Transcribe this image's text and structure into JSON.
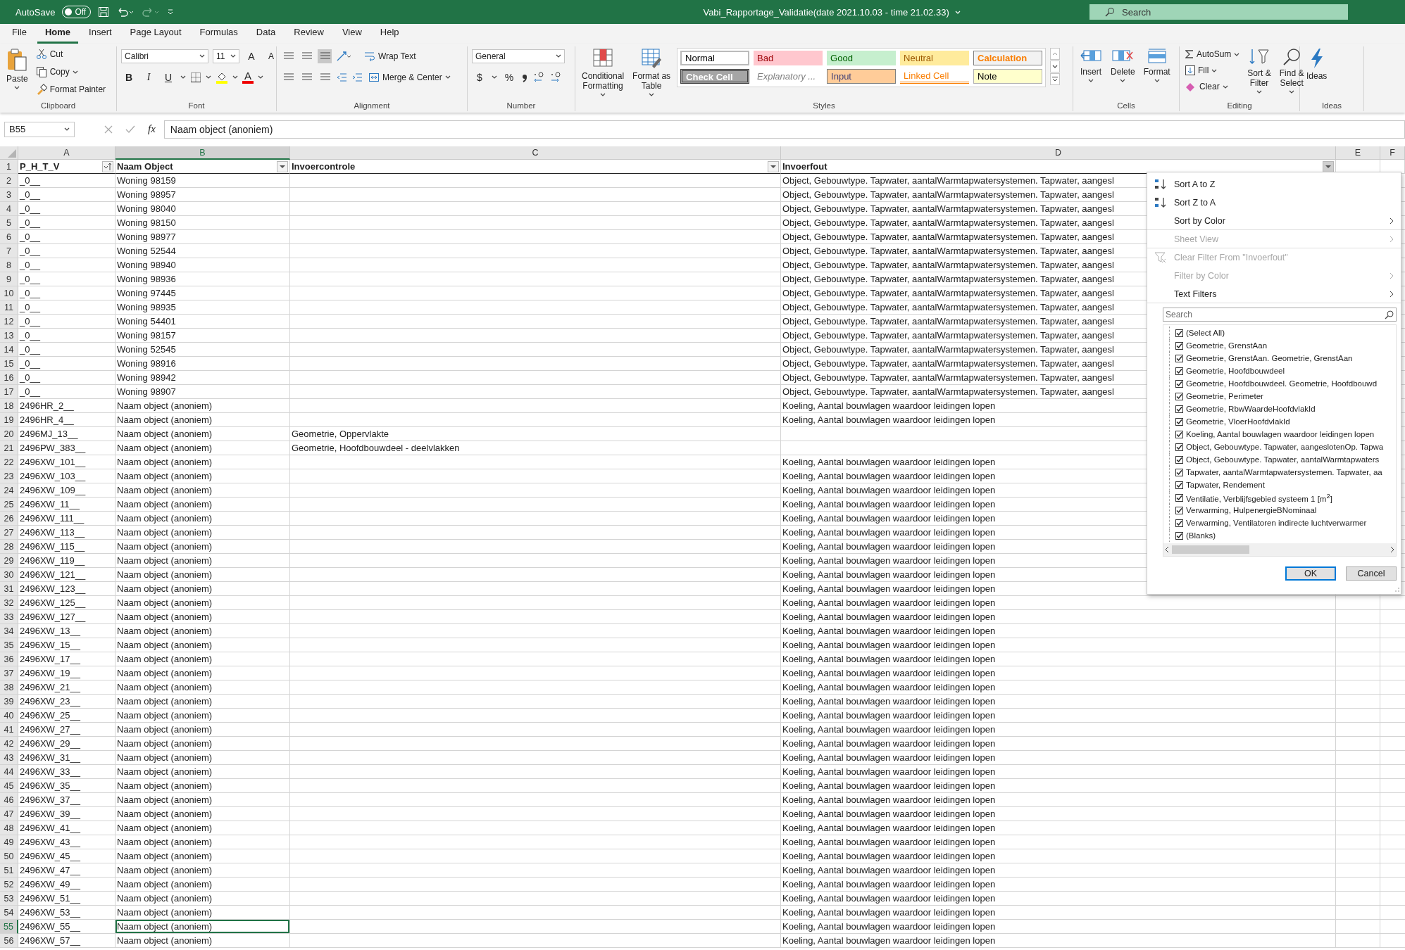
{
  "title_bar": {
    "autosave": {
      "label": "AutoSave",
      "state": "Off",
      "on": false
    },
    "title": "Vabi_Rapportage_Validatie(date 2021.10.03 - time 21.02.33)",
    "search": {
      "placeholder": "Search"
    }
  },
  "menu_tabs": [
    {
      "label": "File",
      "selected": false
    },
    {
      "label": "Home",
      "selected": true
    },
    {
      "label": "Insert",
      "selected": false
    },
    {
      "label": "Page Layout",
      "selected": false
    },
    {
      "label": "Formulas",
      "selected": false
    },
    {
      "label": "Data",
      "selected": false
    },
    {
      "label": "Review",
      "selected": false
    },
    {
      "label": "View",
      "selected": false
    },
    {
      "label": "Help",
      "selected": false
    }
  ],
  "ribbon": {
    "clipboard": {
      "label": "Clipboard",
      "paste": "Paste",
      "cut": "Cut",
      "copy": "Copy",
      "format_painter": "Format Painter"
    },
    "font": {
      "label": "Font",
      "family": "Calibri",
      "size": "11",
      "grow": "A",
      "shrink": "A",
      "bold": "B",
      "italic": "I",
      "underline": "U",
      "font_color": "A"
    },
    "alignment": {
      "label": "Alignment",
      "wrap_text": "Wrap Text",
      "merge_center": "Merge & Center"
    },
    "number": {
      "label": "Number",
      "format": "General",
      "currency": "$",
      "percent": "%"
    },
    "styles": {
      "label": "Styles",
      "conditional": [
        "Conditional",
        "Formatting"
      ],
      "format_table": [
        "Format as",
        "Table"
      ],
      "cell_styles": [
        {
          "text": "Normal",
          "kind": "normal"
        },
        {
          "text": "Bad",
          "kind": "bad"
        },
        {
          "text": "Good",
          "kind": "good"
        },
        {
          "text": "Neutral",
          "kind": "neutral"
        },
        {
          "text": "Calculation",
          "kind": "calculation"
        },
        {
          "text": "Check Cell",
          "kind": "check"
        },
        {
          "text": "Explanatory ...",
          "kind": "explanatory"
        },
        {
          "text": "Input",
          "kind": "input"
        },
        {
          "text": "Linked Cell",
          "kind": "linked"
        },
        {
          "text": "Note",
          "kind": "note"
        }
      ]
    },
    "cells": {
      "label": "Cells",
      "insert": "Insert",
      "delete": "Delete",
      "format": "Format"
    },
    "editing": {
      "label": "Editing",
      "autosum": "AutoSum",
      "fill": "Fill",
      "clear": "Clear",
      "sort_filter": [
        "Sort &",
        "Filter"
      ],
      "find_select": [
        "Find &",
        "Select"
      ]
    },
    "ideas": {
      "label": "Ideas",
      "button": "Ideas"
    }
  },
  "formula_bar": {
    "name_box": "B55",
    "fx": "fx",
    "value": "Naam object (anoniem)"
  },
  "sheet": {
    "columns": [
      {
        "letter": "A",
        "title": "P_H_T_V",
        "kind": "sorted",
        "filter_open": false
      },
      {
        "letter": "B",
        "title": "Naam Object",
        "kind": "filter",
        "filter_open": false
      },
      {
        "letter": "C",
        "title": "Invoercontrole",
        "kind": "filter",
        "filter_open": false
      },
      {
        "letter": "D",
        "title": "Invoerfout",
        "kind": "filter",
        "filter_open": true
      },
      {
        "letter": "E"
      },
      {
        "letter": "F"
      }
    ],
    "header_row": "1",
    "rows": [
      {
        "row": "2",
        "p_h_t_v": "_0__",
        "naam_object": "Woning 98159",
        "invoerfout": "Object, Gebouwtype. Tapwater, aantalWarmtapwatersystemen. Tapwater, aangesl",
        "selected": false
      },
      {
        "row": "3",
        "p_h_t_v": "_0__",
        "naam_object": "Woning 98957",
        "invoerfout": "Object, Gebouwtype. Tapwater, aantalWarmtapwatersystemen. Tapwater, aangesl",
        "selected": false
      },
      {
        "row": "4",
        "p_h_t_v": "_0__",
        "naam_object": "Woning 98040",
        "invoerfout": "Object, Gebouwtype. Tapwater, aantalWarmtapwatersystemen. Tapwater, aangesl",
        "selected": false
      },
      {
        "row": "5",
        "p_h_t_v": "_0__",
        "naam_object": "Woning 98150",
        "invoerfout": "Object, Gebouwtype. Tapwater, aantalWarmtapwatersystemen. Tapwater, aangesl",
        "selected": false
      },
      {
        "row": "6",
        "p_h_t_v": "_0__",
        "naam_object": "Woning 98977",
        "invoerfout": "Object, Gebouwtype. Tapwater, aantalWarmtapwatersystemen. Tapwater, aangesl",
        "selected": false
      },
      {
        "row": "7",
        "p_h_t_v": "_0__",
        "naam_object": "Woning 52544",
        "invoerfout": "Object, Gebouwtype. Tapwater, aantalWarmtapwatersystemen. Tapwater, aangesl",
        "selected": false
      },
      {
        "row": "8",
        "p_h_t_v": "_0__",
        "naam_object": "Woning 98940",
        "invoerfout": "Object, Gebouwtype. Tapwater, aantalWarmtapwatersystemen. Tapwater, aangesl",
        "selected": false
      },
      {
        "row": "9",
        "p_h_t_v": "_0__",
        "naam_object": "Woning 98936",
        "invoerfout": "Object, Gebouwtype. Tapwater, aantalWarmtapwatersystemen. Tapwater, aangesl",
        "selected": false
      },
      {
        "row": "10",
        "p_h_t_v": "_0__",
        "naam_object": "Woning 97445",
        "invoerfout": "Object, Gebouwtype. Tapwater, aantalWarmtapwatersystemen. Tapwater, aangesl",
        "selected": false
      },
      {
        "row": "11",
        "p_h_t_v": "_0__",
        "naam_object": "Woning 98935",
        "invoerfout": "Object, Gebouwtype. Tapwater, aantalWarmtapwatersystemen. Tapwater, aangesl",
        "selected": false
      },
      {
        "row": "12",
        "p_h_t_v": "_0__",
        "naam_object": "Woning 54401",
        "invoerfout": "Object, Gebouwtype. Tapwater, aantalWarmtapwatersystemen. Tapwater, aangesl",
        "selected": false
      },
      {
        "row": "13",
        "p_h_t_v": "_0__",
        "naam_object": "Woning 98157",
        "invoerfout": "Object, Gebouwtype. Tapwater, aantalWarmtapwatersystemen. Tapwater, aangesl",
        "selected": false
      },
      {
        "row": "14",
        "p_h_t_v": "_0__",
        "naam_object": "Woning 52545",
        "invoerfout": "Object, Gebouwtype. Tapwater, aantalWarmtapwatersystemen. Tapwater, aangesl",
        "selected": false
      },
      {
        "row": "15",
        "p_h_t_v": "_0__",
        "naam_object": "Woning 98916",
        "invoerfout": "Object, Gebouwtype. Tapwater, aantalWarmtapwatersystemen. Tapwater, aangesl",
        "selected": false
      },
      {
        "row": "16",
        "p_h_t_v": "_0__",
        "naam_object": "Woning 98942",
        "invoerfout": "Object, Gebouwtype. Tapwater, aantalWarmtapwatersystemen. Tapwater, aangesl",
        "selected": false
      },
      {
        "row": "17",
        "p_h_t_v": "_0__",
        "naam_object": "Woning 98907",
        "invoerfout": "Object, Gebouwtype. Tapwater, aantalWarmtapwatersystemen. Tapwater, aangesl",
        "selected": false
      },
      {
        "row": "18",
        "p_h_t_v": "2496HR_2__",
        "naam_object": "Naam object (anoniem)",
        "invoerfout": "Koeling, Aantal bouwlagen waardoor leidingen lopen",
        "selected": false
      },
      {
        "row": "19",
        "p_h_t_v": "2496HR_4__",
        "naam_object": "Naam object (anoniem)",
        "invoerfout": "Koeling, Aantal bouwlagen waardoor leidingen lopen",
        "selected": false
      },
      {
        "row": "20",
        "p_h_t_v": "2496MJ_13__",
        "naam_object": "Naam object (anoniem)",
        "invoercontrole": "Geometrie, Oppervlakte",
        "selected": false
      },
      {
        "row": "21",
        "p_h_t_v": "2496PW_383__",
        "naam_object": "Naam object (anoniem)",
        "invoercontrole": "Geometrie, Hoofdbouwdeel - deelvlakken",
        "selected": false
      },
      {
        "row": "22",
        "p_h_t_v": "2496XW_101__",
        "naam_object": "Naam object (anoniem)",
        "invoerfout": "Koeling, Aantal bouwlagen waardoor leidingen lopen",
        "selected": false
      },
      {
        "row": "23",
        "p_h_t_v": "2496XW_103__",
        "naam_object": "Naam object (anoniem)",
        "invoerfout": "Koeling, Aantal bouwlagen waardoor leidingen lopen",
        "selected": false
      },
      {
        "row": "24",
        "p_h_t_v": "2496XW_109__",
        "naam_object": "Naam object (anoniem)",
        "invoerfout": "Koeling, Aantal bouwlagen waardoor leidingen lopen",
        "selected": false
      },
      {
        "row": "25",
        "p_h_t_v": "2496XW_11__",
        "naam_object": "Naam object (anoniem)",
        "invoerfout": "Koeling, Aantal bouwlagen waardoor leidingen lopen",
        "selected": false
      },
      {
        "row": "26",
        "p_h_t_v": "2496XW_111__",
        "naam_object": "Naam object (anoniem)",
        "invoerfout": "Koeling, Aantal bouwlagen waardoor leidingen lopen",
        "selected": false
      },
      {
        "row": "27",
        "p_h_t_v": "2496XW_113__",
        "naam_object": "Naam object (anoniem)",
        "invoerfout": "Koeling, Aantal bouwlagen waardoor leidingen lopen",
        "selected": false
      },
      {
        "row": "28",
        "p_h_t_v": "2496XW_115__",
        "naam_object": "Naam object (anoniem)",
        "invoerfout": "Koeling, Aantal bouwlagen waardoor leidingen lopen",
        "selected": false
      },
      {
        "row": "29",
        "p_h_t_v": "2496XW_119__",
        "naam_object": "Naam object (anoniem)",
        "invoerfout": "Koeling, Aantal bouwlagen waardoor leidingen lopen",
        "selected": false
      },
      {
        "row": "30",
        "p_h_t_v": "2496XW_121__",
        "naam_object": "Naam object (anoniem)",
        "invoerfout": "Koeling, Aantal bouwlagen waardoor leidingen lopen",
        "selected": false
      },
      {
        "row": "31",
        "p_h_t_v": "2496XW_123__",
        "naam_object": "Naam object (anoniem)",
        "invoerfout": "Koeling, Aantal bouwlagen waardoor leidingen lopen",
        "selected": false
      },
      {
        "row": "32",
        "p_h_t_v": "2496XW_125__",
        "naam_object": "Naam object (anoniem)",
        "invoerfout": "Koeling, Aantal bouwlagen waardoor leidingen lopen",
        "selected": false
      },
      {
        "row": "33",
        "p_h_t_v": "2496XW_127__",
        "naam_object": "Naam object (anoniem)",
        "invoerfout": "Koeling, Aantal bouwlagen waardoor leidingen lopen",
        "selected": false
      },
      {
        "row": "34",
        "p_h_t_v": "2496XW_13__",
        "naam_object": "Naam object (anoniem)",
        "invoerfout": "Koeling, Aantal bouwlagen waardoor leidingen lopen",
        "selected": false
      },
      {
        "row": "35",
        "p_h_t_v": "2496XW_15__",
        "naam_object": "Naam object (anoniem)",
        "invoerfout": "Koeling, Aantal bouwlagen waardoor leidingen lopen",
        "selected": false
      },
      {
        "row": "36",
        "p_h_t_v": "2496XW_17__",
        "naam_object": "Naam object (anoniem)",
        "invoerfout": "Koeling, Aantal bouwlagen waardoor leidingen lopen",
        "selected": false
      },
      {
        "row": "37",
        "p_h_t_v": "2496XW_19__",
        "naam_object": "Naam object (anoniem)",
        "invoerfout": "Koeling, Aantal bouwlagen waardoor leidingen lopen",
        "selected": false
      },
      {
        "row": "38",
        "p_h_t_v": "2496XW_21__",
        "naam_object": "Naam object (anoniem)",
        "invoerfout": "Koeling, Aantal bouwlagen waardoor leidingen lopen",
        "selected": false
      },
      {
        "row": "39",
        "p_h_t_v": "2496XW_23__",
        "naam_object": "Naam object (anoniem)",
        "invoerfout": "Koeling, Aantal bouwlagen waardoor leidingen lopen",
        "selected": false
      },
      {
        "row": "40",
        "p_h_t_v": "2496XW_25__",
        "naam_object": "Naam object (anoniem)",
        "invoerfout": "Koeling, Aantal bouwlagen waardoor leidingen lopen",
        "selected": false
      },
      {
        "row": "41",
        "p_h_t_v": "2496XW_27__",
        "naam_object": "Naam object (anoniem)",
        "invoerfout": "Koeling, Aantal bouwlagen waardoor leidingen lopen",
        "selected": false
      },
      {
        "row": "42",
        "p_h_t_v": "2496XW_29__",
        "naam_object": "Naam object (anoniem)",
        "invoerfout": "Koeling, Aantal bouwlagen waardoor leidingen lopen",
        "selected": false
      },
      {
        "row": "43",
        "p_h_t_v": "2496XW_31__",
        "naam_object": "Naam object (anoniem)",
        "invoerfout": "Koeling, Aantal bouwlagen waardoor leidingen lopen",
        "selected": false
      },
      {
        "row": "44",
        "p_h_t_v": "2496XW_33__",
        "naam_object": "Naam object (anoniem)",
        "invoerfout": "Koeling, Aantal bouwlagen waardoor leidingen lopen",
        "selected": false
      },
      {
        "row": "45",
        "p_h_t_v": "2496XW_35__",
        "naam_object": "Naam object (anoniem)",
        "invoerfout": "Koeling, Aantal bouwlagen waardoor leidingen lopen",
        "selected": false
      },
      {
        "row": "46",
        "p_h_t_v": "2496XW_37__",
        "naam_object": "Naam object (anoniem)",
        "invoerfout": "Koeling, Aantal bouwlagen waardoor leidingen lopen",
        "selected": false
      },
      {
        "row": "47",
        "p_h_t_v": "2496XW_39__",
        "naam_object": "Naam object (anoniem)",
        "invoerfout": "Koeling, Aantal bouwlagen waardoor leidingen lopen",
        "selected": false
      },
      {
        "row": "48",
        "p_h_t_v": "2496XW_41__",
        "naam_object": "Naam object (anoniem)",
        "invoerfout": "Koeling, Aantal bouwlagen waardoor leidingen lopen",
        "selected": false
      },
      {
        "row": "49",
        "p_h_t_v": "2496XW_43__",
        "naam_object": "Naam object (anoniem)",
        "invoerfout": "Koeling, Aantal bouwlagen waardoor leidingen lopen",
        "selected": false
      },
      {
        "row": "50",
        "p_h_t_v": "2496XW_45__",
        "naam_object": "Naam object (anoniem)",
        "invoerfout": "Koeling, Aantal bouwlagen waardoor leidingen lopen",
        "selected": false
      },
      {
        "row": "51",
        "p_h_t_v": "2496XW_47__",
        "naam_object": "Naam object (anoniem)",
        "invoerfout": "Koeling, Aantal bouwlagen waardoor leidingen lopen",
        "selected": false
      },
      {
        "row": "52",
        "p_h_t_v": "2496XW_49__",
        "naam_object": "Naam object (anoniem)",
        "invoerfout": "Koeling, Aantal bouwlagen waardoor leidingen lopen",
        "selected": false
      },
      {
        "row": "53",
        "p_h_t_v": "2496XW_51__",
        "naam_object": "Naam object (anoniem)",
        "invoerfout": "Koeling, Aantal bouwlagen waardoor leidingen lopen",
        "selected": false
      },
      {
        "row": "54",
        "p_h_t_v": "2496XW_53__",
        "naam_object": "Naam object (anoniem)",
        "invoerfout": "Koeling, Aantal bouwlagen waardoor leidingen lopen",
        "selected": false
      },
      {
        "row": "55",
        "p_h_t_v": "2496XW_55__",
        "naam_object": "Naam object (anoniem)",
        "invoerfout": "Koeling, Aantal bouwlagen waardoor leidingen lopen",
        "selected": true
      },
      {
        "row": "56",
        "p_h_t_v": "2496XW_57__",
        "naam_object": "Naam object (anoniem)",
        "invoerfout": "Koeling, Aantal bouwlagen waardoor leidingen lopen",
        "selected": false
      }
    ]
  },
  "filter_menu": {
    "items": [
      {
        "text": "Sort A to Z",
        "kind": "sort-az",
        "submenu": false,
        "disabled": false,
        "separator": false
      },
      {
        "text": "Sort Z to A",
        "kind": "sort-za",
        "submenu": false,
        "disabled": false,
        "separator": false
      },
      {
        "text": "Sort by Color",
        "kind": "plain",
        "submenu": true,
        "disabled": false,
        "separator": true
      },
      {
        "text": "Sheet View",
        "kind": "plain",
        "submenu": true,
        "disabled": true,
        "separator": true
      },
      {
        "text": "Clear Filter From \"Invoerfout\"",
        "kind": "clear-filter",
        "submenu": false,
        "disabled": true,
        "separator": false
      },
      {
        "text": "Filter by Color",
        "kind": "plain",
        "submenu": true,
        "disabled": true,
        "separator": false
      },
      {
        "text": "Text Filters",
        "kind": "plain",
        "submenu": true,
        "disabled": false,
        "separator": true
      }
    ],
    "search": {
      "placeholder": "Search"
    },
    "values": [
      {
        "text": "(Select All)",
        "checked": true
      },
      {
        "text": "Geometrie, GrenstAan",
        "checked": true
      },
      {
        "text": "Geometrie, GrenstAan. Geometrie, GrenstAan",
        "checked": true
      },
      {
        "text": "Geometrie, Hoofdbouwdeel",
        "checked": true
      },
      {
        "text": "Geometrie, Hoofdbouwdeel. Geometrie, Hoofdbouwd",
        "checked": true
      },
      {
        "text": "Geometrie, Perimeter",
        "checked": true
      },
      {
        "text": "Geometrie, RbwWaardeHoofdvlakId",
        "checked": true
      },
      {
        "text": "Geometrie, VloerHoofdvlakId",
        "checked": true
      },
      {
        "text": "Koeling, Aantal bouwlagen waardoor leidingen lopen",
        "checked": true
      },
      {
        "text": "Object, Gebouwtype. Tapwater, aangeslotenOp. Tapwa",
        "checked": true
      },
      {
        "text": "Object, Gebouwtype. Tapwater, aantalWarmtapwaters",
        "checked": true
      },
      {
        "text": "Tapwater, aantalWarmtapwatersystemen. Tapwater, aa",
        "checked": true
      },
      {
        "text": "Tapwater, Rendement",
        "checked": true
      },
      {
        "text": "Ventilatie, Verblijfsgebied systeem 1 [m$^{2}$]",
        "checked": true
      },
      {
        "text": "Verwarming, HulpenergieBNominaal",
        "checked": true
      },
      {
        "text": "Verwarming, Ventilatoren indirecte luchtverwarmer",
        "checked": true
      },
      {
        "text": "(Blanks)",
        "checked": true
      }
    ],
    "buttons": [
      {
        "text": "OK",
        "kind": "default"
      },
      {
        "text": "Cancel",
        "kind": "normal"
      }
    ]
  }
}
